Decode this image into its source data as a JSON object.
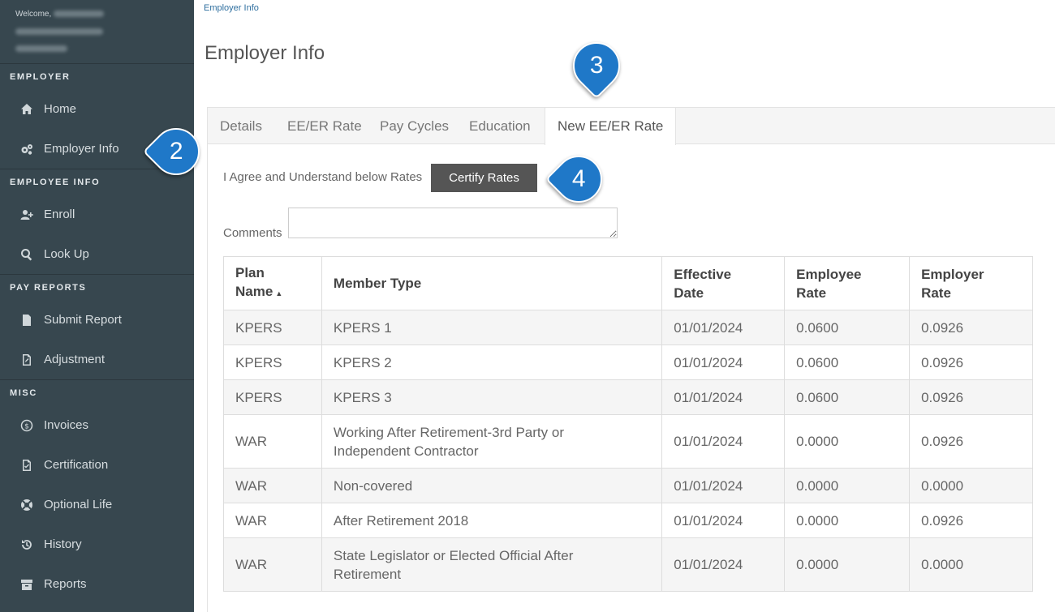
{
  "sidebar": {
    "welcome_label": "Welcome,",
    "sections": [
      {
        "title": "EMPLOYER",
        "items": [
          {
            "label": "Home",
            "icon": "home-icon"
          },
          {
            "label": "Employer Info",
            "icon": "gears-icon"
          }
        ]
      },
      {
        "title": "EMPLOYEE INFO",
        "items": [
          {
            "label": "Enroll",
            "icon": "user-plus-icon"
          },
          {
            "label": "Look Up",
            "icon": "search-icon"
          }
        ]
      },
      {
        "title": "PAY REPORTS",
        "items": [
          {
            "label": "Submit Report",
            "icon": "file-icon"
          },
          {
            "label": "Adjustment",
            "icon": "file-edit-icon"
          }
        ]
      },
      {
        "title": "MISC",
        "items": [
          {
            "label": "Invoices",
            "icon": "dollar-circle-icon"
          },
          {
            "label": "Certification",
            "icon": "file-check-icon"
          },
          {
            "label": "Optional Life",
            "icon": "lifebuoy-icon"
          },
          {
            "label": "History",
            "icon": "history-icon"
          },
          {
            "label": "Reports",
            "icon": "archive-icon"
          }
        ]
      }
    ]
  },
  "breadcrumb": "Employer Info",
  "page_title": "Employer Info",
  "tabs": [
    "Details",
    "EE/ER Rate",
    "Pay Cycles",
    "Education",
    "New EE/ER Rate"
  ],
  "active_tab": "New EE/ER Rate",
  "agree_text": "I Agree and Understand below Rates",
  "certify_button": "Certify Rates",
  "comments_label": "Comments",
  "table": {
    "headers": [
      "Plan Name",
      "Member Type",
      "Effective Date",
      "Employee Rate",
      "Employer Rate"
    ],
    "header_lines": [
      [
        "Plan",
        "Name"
      ],
      [
        "Member Type"
      ],
      [
        "Effective",
        "Date"
      ],
      [
        "Employee",
        "Rate"
      ],
      [
        "Employer",
        "Rate"
      ]
    ],
    "sort_indicator": "▲",
    "rows": [
      {
        "plan": "KPERS",
        "member_type": "KPERS 1",
        "member_lines": [
          "KPERS 1"
        ],
        "date": "01/01/2024",
        "ee": "0.0600",
        "er": "0.0926"
      },
      {
        "plan": "KPERS",
        "member_type": "KPERS 2",
        "member_lines": [
          "KPERS 2"
        ],
        "date": "01/01/2024",
        "ee": "0.0600",
        "er": "0.0926"
      },
      {
        "plan": "KPERS",
        "member_type": "KPERS 3",
        "member_lines": [
          "KPERS 3"
        ],
        "date": "01/01/2024",
        "ee": "0.0600",
        "er": "0.0926"
      },
      {
        "plan": "WAR",
        "member_type": "Working After Retirement-3rd Party or Independent Contractor",
        "member_lines": [
          "Working After Retirement-3rd Party or",
          "Independent Contractor"
        ],
        "date": "01/01/2024",
        "ee": "0.0000",
        "er": "0.0926"
      },
      {
        "plan": "WAR",
        "member_type": "Non-covered",
        "member_lines": [
          "Non-covered"
        ],
        "date": "01/01/2024",
        "ee": "0.0000",
        "er": "0.0000"
      },
      {
        "plan": "WAR",
        "member_type": "After Retirement 2018",
        "member_lines": [
          "After Retirement 2018"
        ],
        "date": "01/01/2024",
        "ee": "0.0000",
        "er": "0.0926"
      },
      {
        "plan": "WAR",
        "member_type": "State Legislator or Elected Official After Retirement",
        "member_lines": [
          "State Legislator or Elected Official After",
          "Retirement"
        ],
        "date": "01/01/2024",
        "ee": "0.0000",
        "er": "0.0000"
      }
    ]
  },
  "callouts": [
    "2",
    "3",
    "4"
  ],
  "colors": {
    "sidebar_bg": "#37474f",
    "callout": "#1f78c8",
    "button_bg": "#555555",
    "link": "#2f6f9f"
  }
}
